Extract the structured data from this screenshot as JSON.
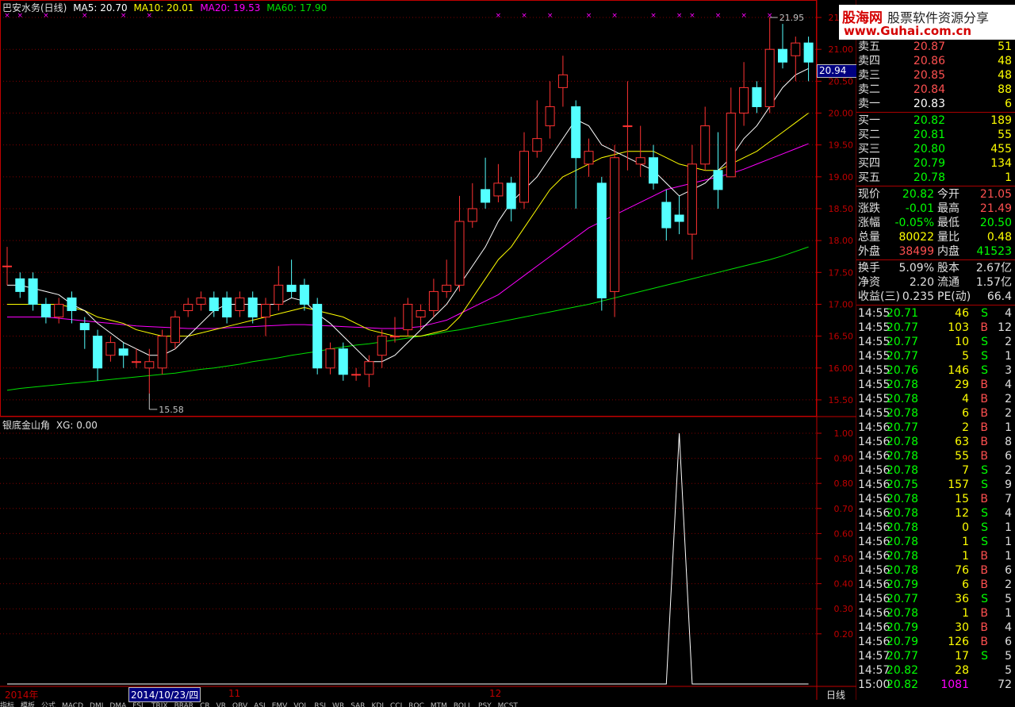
{
  "header": {
    "stock_name": "巴安水务(日线)",
    "ma5": "MA5: 20.70",
    "ma10": "MA10: 20.01",
    "ma20": "MA20: 19.53",
    "ma60": "MA60: 17.90"
  },
  "colors": {
    "up": "#ff3232",
    "down": "#54ffff",
    "ma5": "#ffffff",
    "ma10": "#ffff00",
    "ma20": "#ff00ff",
    "ma60": "#00e000",
    "grid": "#800000",
    "axis": "#c00000"
  },
  "chart_data": [
    {
      "type": "candlestick",
      "y_ticks": [
        "15.50",
        "16.00",
        "16.50",
        "17.00",
        "17.50",
        "18.00",
        "18.50",
        "19.00",
        "19.50",
        "20.00",
        "20.50",
        "21.00",
        "21.50"
      ],
      "ylim": [
        15.3,
        21.6
      ],
      "current_price_label": "20.94",
      "high_label": "21.95",
      "low_label": "15.58",
      "candles": [
        [
          17.6,
          17.6,
          17.9,
          17.3
        ],
        [
          17.4,
          17.2,
          17.5,
          17.1
        ],
        [
          17.4,
          17.0,
          17.5,
          16.9
        ],
        [
          17.0,
          16.8,
          17.1,
          16.7
        ],
        [
          16.8,
          17.0,
          17.1,
          16.7
        ],
        [
          17.1,
          16.9,
          17.2,
          16.7
        ],
        [
          16.7,
          16.6,
          16.8,
          16.3
        ],
        [
          16.5,
          16.0,
          16.6,
          15.8
        ],
        [
          16.2,
          16.4,
          16.5,
          16.1
        ],
        [
          16.3,
          16.2,
          16.4,
          16.0
        ],
        [
          16.1,
          16.1,
          16.3,
          16.0
        ],
        [
          16.0,
          16.1,
          16.3,
          15.6
        ],
        [
          16.0,
          16.5,
          16.6,
          15.9
        ],
        [
          16.4,
          16.8,
          16.9,
          16.3
        ],
        [
          16.9,
          17.0,
          17.1,
          16.8
        ],
        [
          17.0,
          17.1,
          17.2,
          16.9
        ],
        [
          17.1,
          16.9,
          17.2,
          16.8
        ],
        [
          17.1,
          16.8,
          17.2,
          16.7
        ],
        [
          16.9,
          17.1,
          17.2,
          16.8
        ],
        [
          17.1,
          16.8,
          17.2,
          16.7
        ],
        [
          16.8,
          17.0,
          17.1,
          16.5
        ],
        [
          17.0,
          17.3,
          17.6,
          16.9
        ],
        [
          17.3,
          17.2,
          17.7,
          17.1
        ],
        [
          17.3,
          17.0,
          17.4,
          16.9
        ],
        [
          17.0,
          16.0,
          17.1,
          15.9
        ],
        [
          16.0,
          16.3,
          16.4,
          15.9
        ],
        [
          16.3,
          15.9,
          16.4,
          15.8
        ],
        [
          15.9,
          15.9,
          16.0,
          15.8
        ],
        [
          15.9,
          16.1,
          16.2,
          15.7
        ],
        [
          16.2,
          16.5,
          16.6,
          16.0
        ],
        [
          16.5,
          16.5,
          16.8,
          16.4
        ],
        [
          16.6,
          17.0,
          17.1,
          16.5
        ],
        [
          16.8,
          16.9,
          17.0,
          16.6
        ],
        [
          16.9,
          17.2,
          17.4,
          16.8
        ],
        [
          17.2,
          17.3,
          17.7,
          17.1
        ],
        [
          17.3,
          18.3,
          18.7,
          17.2
        ],
        [
          18.3,
          18.5,
          18.9,
          18.2
        ],
        [
          18.8,
          18.6,
          19.3,
          18.5
        ],
        [
          18.7,
          18.9,
          19.2,
          18.6
        ],
        [
          18.9,
          18.5,
          19.0,
          18.3
        ],
        [
          18.6,
          19.4,
          19.7,
          18.5
        ],
        [
          19.4,
          19.6,
          20.2,
          19.3
        ],
        [
          19.8,
          20.1,
          20.5,
          19.6
        ],
        [
          20.4,
          20.6,
          20.9,
          20.1
        ],
        [
          20.1,
          19.3,
          20.2,
          18.5
        ],
        [
          19.2,
          19.4,
          19.6,
          19.0
        ],
        [
          18.9,
          17.1,
          19.0,
          16.9
        ],
        [
          17.2,
          19.3,
          19.5,
          16.8
        ],
        [
          19.8,
          19.8,
          20.5,
          19.1
        ],
        [
          19.2,
          19.3,
          19.8,
          19.0
        ],
        [
          19.3,
          18.9,
          19.5,
          18.8
        ],
        [
          18.6,
          18.2,
          18.8,
          18.0
        ],
        [
          18.4,
          18.3,
          18.7,
          18.1
        ],
        [
          18.1,
          19.2,
          19.5,
          17.7
        ],
        [
          19.2,
          19.8,
          20.1,
          19.1
        ],
        [
          19.1,
          18.8,
          19.7,
          18.5
        ],
        [
          19.0,
          20.0,
          20.4,
          19.0
        ],
        [
          20.0,
          20.4,
          20.8,
          19.8
        ],
        [
          20.4,
          20.1,
          20.5,
          20.0
        ],
        [
          20.1,
          21.0,
          21.5,
          20.0
        ],
        [
          21.0,
          20.8,
          21.4,
          20.7
        ],
        [
          20.9,
          21.1,
          21.2,
          20.5
        ],
        [
          21.1,
          20.8,
          21.2,
          20.5
        ]
      ],
      "ma5": [
        17.3,
        17.3,
        17.25,
        17.2,
        17.15,
        17.0,
        16.9,
        16.7,
        16.55,
        16.4,
        16.3,
        16.2,
        16.2,
        16.3,
        16.5,
        16.7,
        16.9,
        17.0,
        17.0,
        17.0,
        17.0,
        17.0,
        17.1,
        17.05,
        16.85,
        16.7,
        16.5,
        16.3,
        16.1,
        16.1,
        16.2,
        16.4,
        16.6,
        16.8,
        17.0,
        17.3,
        17.6,
        17.9,
        18.3,
        18.6,
        18.8,
        19.0,
        19.3,
        19.6,
        19.9,
        19.8,
        19.5,
        19.4,
        19.3,
        19.2,
        19.1,
        18.9,
        18.7,
        18.8,
        18.9,
        19.1,
        19.3,
        19.6,
        19.8,
        20.1,
        20.4,
        20.6,
        20.7
      ],
      "ma10": [
        17.0,
        17.0,
        17.0,
        17.0,
        17.0,
        16.95,
        16.9,
        16.8,
        16.75,
        16.7,
        16.6,
        16.55,
        16.5,
        16.5,
        16.5,
        16.55,
        16.6,
        16.65,
        16.7,
        16.75,
        16.8,
        16.85,
        16.9,
        16.95,
        16.9,
        16.85,
        16.8,
        16.7,
        16.6,
        16.55,
        16.5,
        16.5,
        16.5,
        16.55,
        16.6,
        16.8,
        17.1,
        17.4,
        17.7,
        17.9,
        18.2,
        18.5,
        18.8,
        19.0,
        19.1,
        19.2,
        19.3,
        19.35,
        19.4,
        19.4,
        19.4,
        19.3,
        19.2,
        19.15,
        19.1,
        19.1,
        19.2,
        19.3,
        19.4,
        19.55,
        19.7,
        19.85,
        20.0
      ],
      "ma20": [
        16.8,
        16.8,
        16.8,
        16.8,
        16.78,
        16.76,
        16.74,
        16.72,
        16.7,
        16.68,
        16.66,
        16.65,
        16.64,
        16.63,
        16.62,
        16.62,
        16.62,
        16.63,
        16.64,
        16.65,
        16.66,
        16.67,
        16.68,
        16.68,
        16.67,
        16.66,
        16.65,
        16.64,
        16.63,
        16.62,
        16.62,
        16.63,
        16.65,
        16.7,
        16.75,
        16.85,
        16.95,
        17.05,
        17.15,
        17.3,
        17.45,
        17.6,
        17.75,
        17.9,
        18.05,
        18.2,
        18.3,
        18.4,
        18.5,
        18.6,
        18.7,
        18.8,
        18.85,
        18.9,
        18.95,
        19.0,
        19.05,
        19.12,
        19.2,
        19.28,
        19.36,
        19.44,
        19.52
      ],
      "ma60": [
        15.65,
        15.68,
        15.7,
        15.72,
        15.74,
        15.76,
        15.78,
        15.8,
        15.82,
        15.84,
        15.86,
        15.88,
        15.9,
        15.92,
        15.95,
        15.98,
        16.0,
        16.03,
        16.06,
        16.1,
        16.13,
        16.16,
        16.2,
        16.23,
        16.26,
        16.3,
        16.33,
        16.36,
        16.38,
        16.41,
        16.44,
        16.47,
        16.5,
        16.53,
        16.57,
        16.6,
        16.64,
        16.68,
        16.72,
        16.76,
        16.8,
        16.84,
        16.88,
        16.92,
        16.96,
        17.0,
        17.05,
        17.1,
        17.15,
        17.2,
        17.25,
        17.3,
        17.35,
        17.4,
        17.45,
        17.5,
        17.55,
        17.6,
        17.65,
        17.7,
        17.76,
        17.83,
        17.9
      ]
    },
    {
      "type": "line",
      "title": "银底金山角",
      "legend": "XG: 0.00",
      "y_ticks": [
        "0.20",
        "0.30",
        "0.40",
        "0.50",
        "0.60",
        "0.70",
        "0.80",
        "0.90",
        "1.00"
      ],
      "ylim": [
        0,
        1.0
      ],
      "values": [
        0,
        0,
        0,
        0,
        0,
        0,
        0,
        0,
        0,
        0,
        0,
        0,
        0,
        0,
        0,
        0,
        0,
        0,
        0,
        0,
        0,
        0,
        0,
        0,
        0,
        0,
        0,
        0,
        0,
        0,
        0,
        0,
        0,
        0,
        0,
        0,
        0,
        0,
        0,
        0,
        0,
        0,
        0,
        0,
        0,
        0,
        0,
        0,
        0,
        0,
        0,
        0,
        1,
        0,
        0,
        0,
        0,
        0,
        0,
        0,
        0,
        0,
        0
      ]
    }
  ],
  "xaxis": {
    "label_2014": "2014年",
    "date_box": "2014/10/23/四",
    "label_11": "11",
    "label_12": "12"
  },
  "period_label": "日线",
  "watermark": {
    "line1": "股海网",
    "line1b": "股票软件资源分享",
    "line2": "www.Guhai.com.cn"
  },
  "orderbook": {
    "sells": [
      {
        "label": "卖五",
        "price": "20.87",
        "vol": "51"
      },
      {
        "label": "卖四",
        "price": "20.86",
        "vol": "48"
      },
      {
        "label": "卖三",
        "price": "20.85",
        "vol": "48"
      },
      {
        "label": "卖二",
        "price": "20.84",
        "vol": "88"
      },
      {
        "label": "卖一",
        "price": "20.83",
        "vol": "6"
      }
    ],
    "buys": [
      {
        "label": "买一",
        "price": "20.82",
        "vol": "189"
      },
      {
        "label": "买二",
        "price": "20.81",
        "vol": "55"
      },
      {
        "label": "买三",
        "price": "20.80",
        "vol": "455"
      },
      {
        "label": "买四",
        "price": "20.79",
        "vol": "134"
      },
      {
        "label": "买五",
        "price": "20.78",
        "vol": "1"
      }
    ]
  },
  "quote": [
    {
      "l1": "现价",
      "v1": "20.82",
      "c1": "#00ff00",
      "l2": "今开",
      "v2": "21.05",
      "c2": "#ff5050"
    },
    {
      "l1": "涨跌",
      "v1": "-0.01",
      "c1": "#00ff00",
      "l2": "最高",
      "v2": "21.49",
      "c2": "#ff5050"
    },
    {
      "l1": "涨幅",
      "v1": "-0.05%",
      "c1": "#00ff00",
      "l2": "最低",
      "v2": "20.50",
      "c2": "#00ff00"
    },
    {
      "l1": "总量",
      "v1": "80022",
      "c1": "#ffff00",
      "l2": "量比",
      "v2": "0.48",
      "c2": "#ffff00"
    },
    {
      "l1": "外盘",
      "v1": "38499",
      "c1": "#ff5050",
      "l2": "内盘",
      "v2": "41523",
      "c2": "#00ff00"
    }
  ],
  "fundamentals": [
    {
      "l1": "换手",
      "v1": "5.09%",
      "l2": "股本",
      "v2": "2.67亿"
    },
    {
      "l1": "净资",
      "v1": "2.20",
      "l2": "流通",
      "v2": "1.57亿"
    },
    {
      "l1": "收益(三)",
      "v1": "0.235",
      "l2": "PE(动)",
      "v2": "66.4"
    }
  ],
  "ticks": [
    [
      "14:55",
      "20.71",
      "46",
      "S",
      "4"
    ],
    [
      "14:55",
      "20.77",
      "103",
      "B",
      "12"
    ],
    [
      "14:55",
      "20.77",
      "10",
      "S",
      "2"
    ],
    [
      "14:55",
      "20.77",
      "5",
      "S",
      "1"
    ],
    [
      "14:55",
      "20.76",
      "146",
      "S",
      "3"
    ],
    [
      "14:55",
      "20.78",
      "29",
      "B",
      "4"
    ],
    [
      "14:55",
      "20.78",
      "4",
      "B",
      "2"
    ],
    [
      "14:55",
      "20.78",
      "6",
      "B",
      "2"
    ],
    [
      "14:56",
      "20.77",
      "2",
      "B",
      "1"
    ],
    [
      "14:56",
      "20.78",
      "63",
      "B",
      "8"
    ],
    [
      "14:56",
      "20.78",
      "55",
      "B",
      "6"
    ],
    [
      "14:56",
      "20.78",
      "7",
      "S",
      "2"
    ],
    [
      "14:56",
      "20.75",
      "157",
      "S",
      "9"
    ],
    [
      "14:56",
      "20.78",
      "15",
      "B",
      "7"
    ],
    [
      "14:56",
      "20.78",
      "12",
      "S",
      "4"
    ],
    [
      "14:56",
      "20.78",
      "0",
      "S",
      "1"
    ],
    [
      "14:56",
      "20.78",
      "1",
      "S",
      "1"
    ],
    [
      "14:56",
      "20.78",
      "1",
      "B",
      "1"
    ],
    [
      "14:56",
      "20.78",
      "76",
      "B",
      "6"
    ],
    [
      "14:56",
      "20.79",
      "6",
      "B",
      "2"
    ],
    [
      "14:56",
      "20.77",
      "36",
      "S",
      "5"
    ],
    [
      "14:56",
      "20.78",
      "1",
      "B",
      "1"
    ],
    [
      "14:56",
      "20.79",
      "30",
      "B",
      "4"
    ],
    [
      "14:56",
      "20.79",
      "126",
      "B",
      "6"
    ],
    [
      "14:57",
      "20.77",
      "17",
      "S",
      "5"
    ],
    [
      "14:57",
      "20.82",
      "28",
      "",
      "5"
    ],
    [
      "15:00",
      "20.82",
      "1081",
      "",
      "72"
    ]
  ],
  "bottom_tabs": [
    "指标",
    "模板",
    "公式",
    "MACD",
    "DMI",
    "DMA",
    "FSL",
    "TRIX",
    "BRAR",
    "CR",
    "VR",
    "OBV",
    "ASI",
    "EMV",
    "VOL",
    "RSI",
    "WR",
    "SAR",
    "KDJ",
    "CCI",
    "ROC",
    "MTM",
    "BOLL",
    "PSY",
    "MCST"
  ]
}
